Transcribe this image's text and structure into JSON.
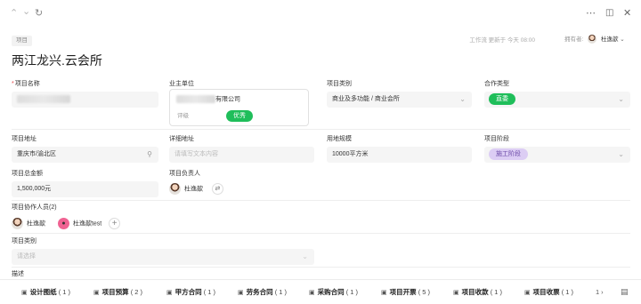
{
  "topbar": {
    "icons": [
      "chevron-up-icon",
      "chevron-down-icon",
      "refresh-icon",
      "more-icon",
      "panel-icon",
      "close-icon"
    ]
  },
  "header": {
    "type_tag": "项目",
    "title": "两江龙兴.云会所",
    "meta": "工作流 更新于 今天 08:00",
    "owner_label": "拥有者:",
    "owner_name": "杜逸歆"
  },
  "fields": {
    "project_name": {
      "label": "项目名称"
    },
    "owner_unit": {
      "label": "业主单位",
      "company_suffix": "有限公司",
      "rating_label": "评级",
      "rating_value": "优秀"
    },
    "project_category": {
      "label": "项目类别",
      "value": "商业及多功能 / 商业会所"
    },
    "cooperation_type": {
      "label": "合作类型",
      "value": "直委"
    },
    "project_address": {
      "label": "项目地址",
      "value": "重庆市/渝北区"
    },
    "detail_address": {
      "label": "详细地址",
      "placeholder": "请填写文本内容"
    },
    "land_scale": {
      "label": "用地规模",
      "value": "10000平方米"
    },
    "project_stage": {
      "label": "项目阶段",
      "value": "施工阶段"
    },
    "total_amount": {
      "label": "项目总金额",
      "value": "1,500,000元"
    },
    "project_lead": {
      "label": "项目负责人",
      "name": "杜逸歆"
    },
    "collaborators": {
      "label": "项目协作人员(2)",
      "people": [
        {
          "name": "杜逸歆"
        },
        {
          "name": "杜逸歆test"
        }
      ]
    },
    "project_type": {
      "label": "项目类别",
      "placeholder": "请选择"
    },
    "description": {
      "label": "描述"
    }
  },
  "bottom_tabs": [
    {
      "label": "设计图纸",
      "count": "( 1 )"
    },
    {
      "label": "项目预算",
      "count": "( 2 )"
    },
    {
      "label": "甲方合同",
      "count": "( 1 )"
    },
    {
      "label": "劳务合同",
      "count": "( 1 )"
    },
    {
      "label": "采购合同",
      "count": "( 1 )"
    },
    {
      "label": "项目开票",
      "count": "( 5 )"
    },
    {
      "label": "项目收款",
      "count": "( 1 )"
    },
    {
      "label": "项目收票",
      "count": "( 1 )"
    },
    {
      "label": "1",
      "count": ""
    }
  ],
  "colors": {
    "accent_green": "#1fbe5a",
    "stage_purple": "#dccdf4",
    "required_red": "#e5484d"
  }
}
